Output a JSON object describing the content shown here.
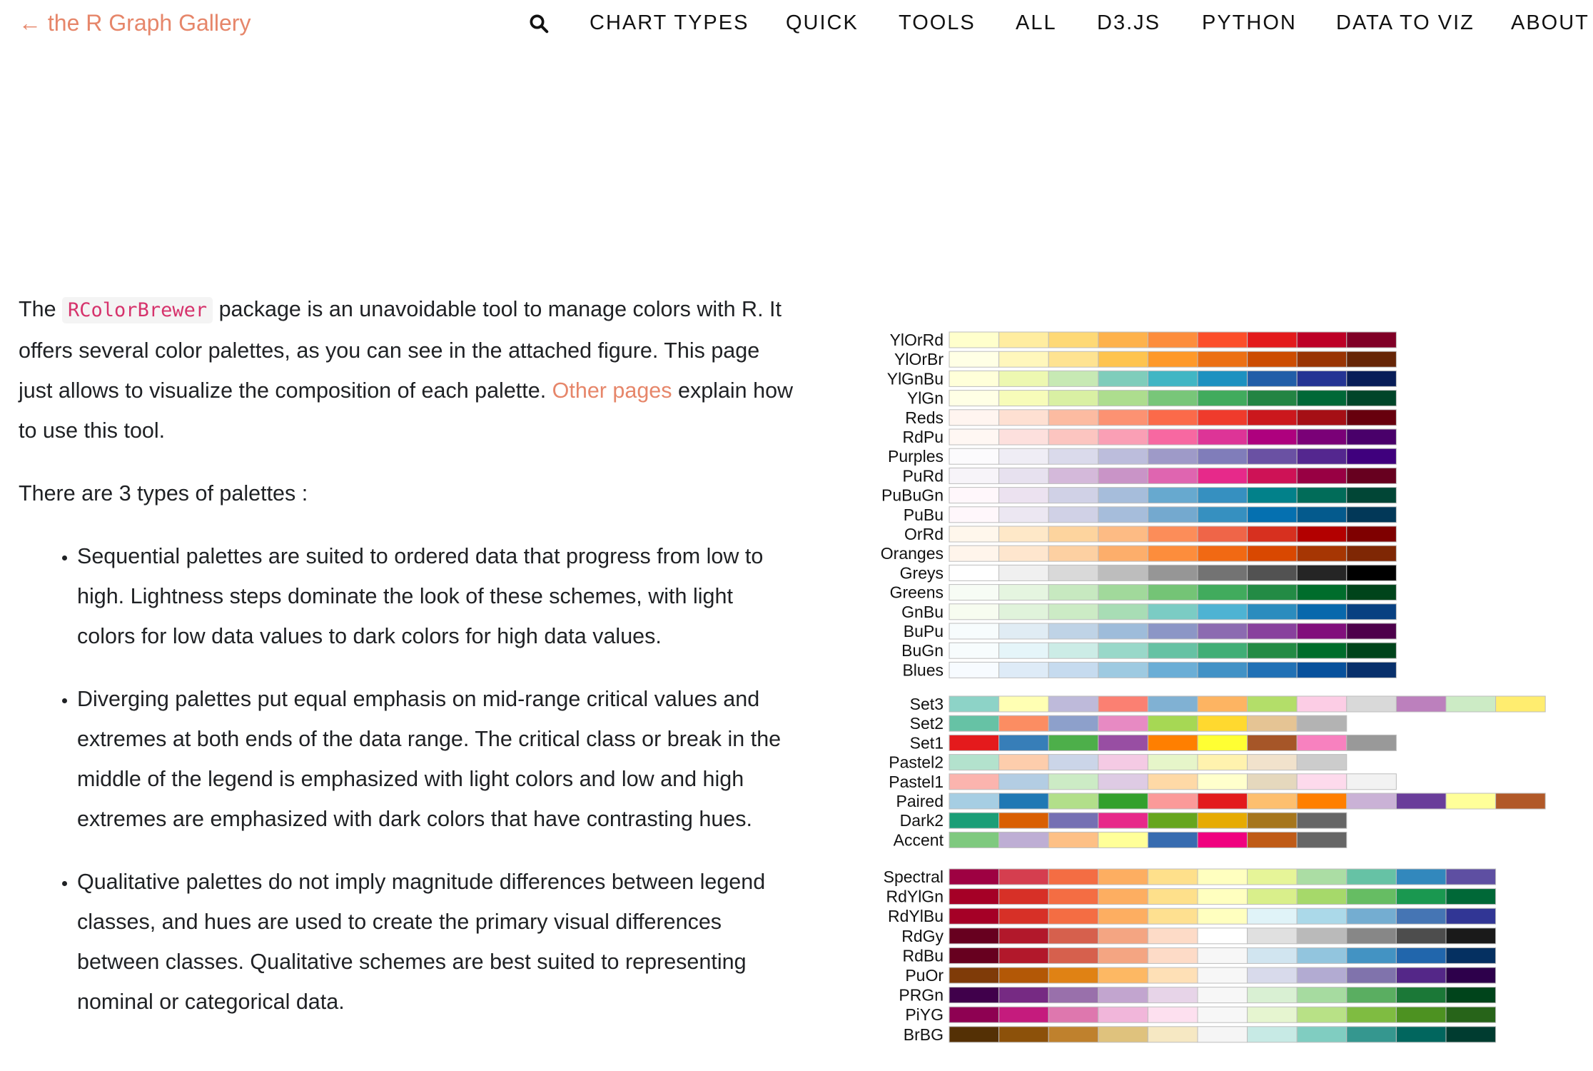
{
  "nav": {
    "back_label": "← the R Graph Gallery",
    "items": [
      {
        "label": "CHART TYPES"
      },
      {
        "label": "QUICK"
      },
      {
        "label": "TOOLS"
      },
      {
        "label": "ALL"
      },
      {
        "label": "D3.JS"
      },
      {
        "label": "PYTHON"
      },
      {
        "label": "DATA TO VIZ"
      },
      {
        "label": "ABOUT"
      }
    ]
  },
  "article": {
    "intro_before": "The ",
    "package_code": "RColorBrewer",
    "intro_after": " package is an unavoidable tool to manage colors with R. It offers several color palettes, as you can see in the attached figure. This page just allows to visualize the composition of each palette. ",
    "intro_link": "Other pages",
    "intro_end": " explain how to use this tool.",
    "types_intro": "There are 3 types of palettes :",
    "bullets": [
      "Sequential palettes are suited to ordered data that progress from low to high. Lightness steps dominate the look of these schemes, with light colors for low data values to dark colors for high data values.",
      "Diverging palettes put equal emphasis on mid-range critical values and extremes at both ends of the data range. The critical class or break in the middle of the legend is emphasized with light colors and low and high extremes are emphasized with dark colors that have contrasting hues.",
      "Qualitative palettes do not imply magnitude differences between legend classes, and hues are used to create the primary visual differences between classes. Qualitative schemes are best suited to representing nominal or categorical data."
    ]
  },
  "palette_groups": [
    {
      "type": "sequential",
      "palettes": [
        {
          "name": "YlOrRd",
          "colors": [
            "#ffffcc",
            "#ffeda0",
            "#fed976",
            "#feb24c",
            "#fd8d3c",
            "#fc4e2a",
            "#e31a1c",
            "#bd0026",
            "#800026"
          ]
        },
        {
          "name": "YlOrBr",
          "colors": [
            "#ffffe5",
            "#fff7bc",
            "#fee391",
            "#fec44f",
            "#fe9929",
            "#ec7014",
            "#cc4c02",
            "#993404",
            "#662506"
          ]
        },
        {
          "name": "YlGnBu",
          "colors": [
            "#ffffd9",
            "#edf8b1",
            "#c7e9b4",
            "#7fcdbb",
            "#41b6c4",
            "#1d91c0",
            "#225ea8",
            "#253494",
            "#081d58"
          ]
        },
        {
          "name": "YlGn",
          "colors": [
            "#ffffe5",
            "#f7fcb9",
            "#d9f0a3",
            "#addd8e",
            "#78c679",
            "#41ab5d",
            "#238443",
            "#006837",
            "#004529"
          ]
        },
        {
          "name": "Reds",
          "colors": [
            "#fff5f0",
            "#fee0d2",
            "#fcbba1",
            "#fc9272",
            "#fb6a4a",
            "#ef3b2c",
            "#cb181d",
            "#a50f15",
            "#67000d"
          ]
        },
        {
          "name": "RdPu",
          "colors": [
            "#fff7f3",
            "#fde0dd",
            "#fcc5c0",
            "#fa9fb5",
            "#f768a1",
            "#dd3497",
            "#ae017e",
            "#7a0177",
            "#49006a"
          ]
        },
        {
          "name": "Purples",
          "colors": [
            "#fcfbfd",
            "#efedf5",
            "#dadaeb",
            "#bcbddc",
            "#9e9ac8",
            "#807dba",
            "#6a51a3",
            "#54278f",
            "#3f007d"
          ]
        },
        {
          "name": "PuRd",
          "colors": [
            "#f7f4f9",
            "#e7e1ef",
            "#d4b9da",
            "#c994c7",
            "#df65b0",
            "#e7298a",
            "#ce1256",
            "#980043",
            "#67001f"
          ]
        },
        {
          "name": "PuBuGn",
          "colors": [
            "#fff7fb",
            "#ece2f0",
            "#d0d1e6",
            "#a6bddb",
            "#67a9cf",
            "#3690c0",
            "#02818a",
            "#016c59",
            "#014636"
          ]
        },
        {
          "name": "PuBu",
          "colors": [
            "#fff7fb",
            "#ece7f2",
            "#d0d1e6",
            "#a6bddb",
            "#74a9cf",
            "#3690c0",
            "#0570b0",
            "#045a8d",
            "#023858"
          ]
        },
        {
          "name": "OrRd",
          "colors": [
            "#fff7ec",
            "#fee8c8",
            "#fdd49e",
            "#fdbb84",
            "#fc8d59",
            "#ef6548",
            "#d7301f",
            "#b30000",
            "#7f0000"
          ]
        },
        {
          "name": "Oranges",
          "colors": [
            "#fff5eb",
            "#fee6ce",
            "#fdd0a2",
            "#fdae6b",
            "#fd8d3c",
            "#f16913",
            "#d94801",
            "#a63603",
            "#7f2704"
          ]
        },
        {
          "name": "Greys",
          "colors": [
            "#ffffff",
            "#f0f0f0",
            "#d9d9d9",
            "#bdbdbd",
            "#969696",
            "#737373",
            "#525252",
            "#252525",
            "#000000"
          ]
        },
        {
          "name": "Greens",
          "colors": [
            "#f7fcf5",
            "#e5f5e0",
            "#c7e9c0",
            "#a1d99b",
            "#74c476",
            "#41ab5d",
            "#238b45",
            "#006d2c",
            "#00441b"
          ]
        },
        {
          "name": "GnBu",
          "colors": [
            "#f7fcf0",
            "#e0f3db",
            "#ccebc5",
            "#a8ddb5",
            "#7bccc4",
            "#4eb3d3",
            "#2b8cbe",
            "#0868ac",
            "#084081"
          ]
        },
        {
          "name": "BuPu",
          "colors": [
            "#f7fcfd",
            "#e0ecf4",
            "#bfd3e6",
            "#9ebcda",
            "#8c96c6",
            "#8c6bb1",
            "#88419d",
            "#810f7c",
            "#4d004b"
          ]
        },
        {
          "name": "BuGn",
          "colors": [
            "#f7fcfd",
            "#e5f5f9",
            "#ccece6",
            "#99d8c9",
            "#66c2a4",
            "#41ae76",
            "#238b45",
            "#006d2c",
            "#00441b"
          ]
        },
        {
          "name": "Blues",
          "colors": [
            "#f7fbff",
            "#deebf7",
            "#c6dbef",
            "#9ecae1",
            "#6baed6",
            "#4292c6",
            "#2171b5",
            "#08519c",
            "#08306b"
          ]
        }
      ]
    },
    {
      "type": "qualitative",
      "palettes": [
        {
          "name": "Set3",
          "colors": [
            "#8dd3c7",
            "#ffffb3",
            "#bebada",
            "#fb8072",
            "#80b1d3",
            "#fdb462",
            "#b3de69",
            "#fccde5",
            "#d9d9d9",
            "#bc80bd",
            "#ccebc5",
            "#ffed6f"
          ]
        },
        {
          "name": "Set2",
          "colors": [
            "#66c2a5",
            "#fc8d62",
            "#8da0cb",
            "#e78ac3",
            "#a6d854",
            "#ffd92f",
            "#e5c494",
            "#b3b3b3"
          ]
        },
        {
          "name": "Set1",
          "colors": [
            "#e41a1c",
            "#377eb8",
            "#4daf4a",
            "#984ea3",
            "#ff7f00",
            "#ffff33",
            "#a65628",
            "#f781bf",
            "#999999"
          ]
        },
        {
          "name": "Pastel2",
          "colors": [
            "#b3e2cd",
            "#fdcdac",
            "#cbd5e8",
            "#f4cae4",
            "#e6f5c9",
            "#fff2ae",
            "#f1e2cc",
            "#cccccc"
          ]
        },
        {
          "name": "Pastel1",
          "colors": [
            "#fbb4ae",
            "#b3cde3",
            "#ccebc5",
            "#decbe4",
            "#fed9a6",
            "#ffffcc",
            "#e5d8bd",
            "#fddaec",
            "#f2f2f2"
          ]
        },
        {
          "name": "Paired",
          "colors": [
            "#a6cee3",
            "#1f78b4",
            "#b2df8a",
            "#33a02c",
            "#fb9a99",
            "#e31a1c",
            "#fdbf6f",
            "#ff7f00",
            "#cab2d6",
            "#6a3d9a",
            "#ffff99",
            "#b15928"
          ]
        },
        {
          "name": "Dark2",
          "colors": [
            "#1b9e77",
            "#d95f02",
            "#7570b3",
            "#e7298a",
            "#66a61e",
            "#e6ab02",
            "#a6761d",
            "#666666"
          ]
        },
        {
          "name": "Accent",
          "colors": [
            "#7fc97f",
            "#beaed4",
            "#fdc086",
            "#ffff99",
            "#386cb0",
            "#f0027f",
            "#bf5b17",
            "#666666"
          ]
        }
      ]
    },
    {
      "type": "diverging",
      "palettes": [
        {
          "name": "Spectral",
          "colors": [
            "#9e0142",
            "#d53e4f",
            "#f46d43",
            "#fdae61",
            "#fee08b",
            "#ffffbf",
            "#e6f598",
            "#abdda4",
            "#66c2a5",
            "#3288bd",
            "#5e4fa2"
          ]
        },
        {
          "name": "RdYlGn",
          "colors": [
            "#a50026",
            "#d73027",
            "#f46d43",
            "#fdae61",
            "#fee08b",
            "#ffffbf",
            "#d9ef8b",
            "#a6d96a",
            "#66bd63",
            "#1a9850",
            "#006837"
          ]
        },
        {
          "name": "RdYlBu",
          "colors": [
            "#a50026",
            "#d73027",
            "#f46d43",
            "#fdae61",
            "#fee090",
            "#ffffbf",
            "#e0f3f8",
            "#abd9e9",
            "#74add1",
            "#4575b4",
            "#313695"
          ]
        },
        {
          "name": "RdGy",
          "colors": [
            "#67001f",
            "#b2182b",
            "#d6604d",
            "#f4a582",
            "#fddbc7",
            "#ffffff",
            "#e0e0e0",
            "#bababa",
            "#878787",
            "#4d4d4d",
            "#1a1a1a"
          ]
        },
        {
          "name": "RdBu",
          "colors": [
            "#67001f",
            "#b2182b",
            "#d6604d",
            "#f4a582",
            "#fddbc7",
            "#f7f7f7",
            "#d1e5f0",
            "#92c5de",
            "#4393c3",
            "#2166ac",
            "#053061"
          ]
        },
        {
          "name": "PuOr",
          "colors": [
            "#7f3b08",
            "#b35806",
            "#e08214",
            "#fdb863",
            "#fee0b6",
            "#f7f7f7",
            "#d8daeb",
            "#b2abd2",
            "#8073ac",
            "#542788",
            "#2d004b"
          ]
        },
        {
          "name": "PRGn",
          "colors": [
            "#40004b",
            "#762a83",
            "#9970ab",
            "#c2a5cf",
            "#e7d4e8",
            "#f7f7f7",
            "#d9f0d3",
            "#a6dba0",
            "#5aae61",
            "#1b7837",
            "#00441b"
          ]
        },
        {
          "name": "PiYG",
          "colors": [
            "#8e0152",
            "#c51b7d",
            "#de77ae",
            "#f1b6da",
            "#fde0ef",
            "#f7f7f7",
            "#e6f5d0",
            "#b8e186",
            "#7fbc41",
            "#4d9221",
            "#276419"
          ]
        },
        {
          "name": "BrBG",
          "colors": [
            "#543005",
            "#8c510a",
            "#bf812d",
            "#dfc27d",
            "#f6e8c3",
            "#f5f5f5",
            "#c7eae5",
            "#80cdc1",
            "#35978f",
            "#01665e",
            "#003c30"
          ]
        }
      ]
    }
  ]
}
